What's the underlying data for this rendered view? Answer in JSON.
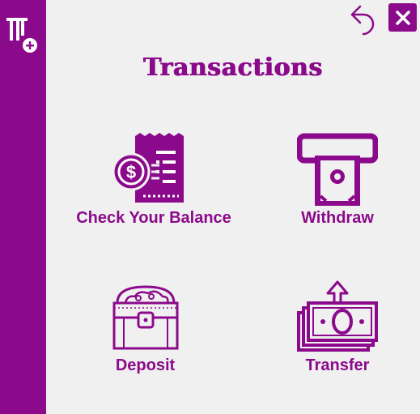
{
  "title": "Transactions",
  "actions": {
    "check_balance": "Check Your Balance",
    "withdraw": "Withdraw",
    "deposit": "Deposit",
    "transfer": "Transfer"
  },
  "icons": {
    "sidebar_logo": "atm-card-add-icon",
    "undo": "undo-icon",
    "close": "close-icon",
    "check_balance": "receipt-dollar-icon",
    "withdraw": "atm-cash-icon",
    "deposit": "treasure-chest-icon",
    "transfer": "money-transfer-icon"
  },
  "colors": {
    "accent": "#8b0a8b",
    "background": "#f0f0f0"
  }
}
